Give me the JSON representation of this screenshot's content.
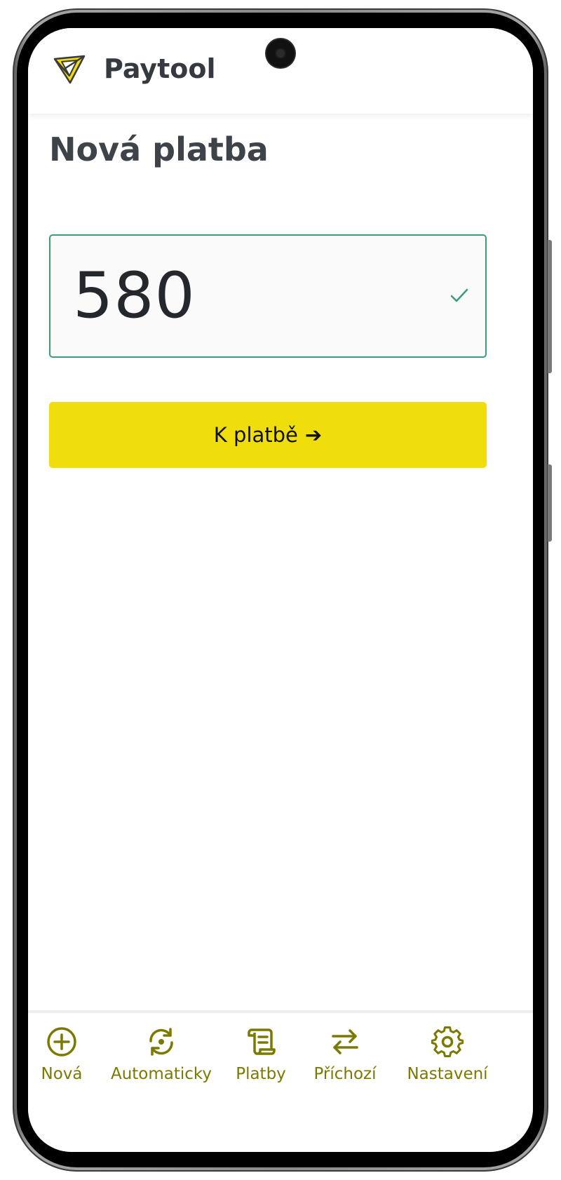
{
  "app": {
    "name": "Paytool",
    "logo_icon": "paytool-logo-icon"
  },
  "page": {
    "title": "Nová platba"
  },
  "amount_field": {
    "value": "580",
    "status_icon": "check-icon"
  },
  "pay_button": {
    "label": "K platbě",
    "arrow": "➔"
  },
  "bottom_nav": {
    "items": [
      {
        "label": "Nová",
        "icon": "plus-circle-icon"
      },
      {
        "label": "Automaticky",
        "icon": "refresh-icon"
      },
      {
        "label": "Platby",
        "icon": "scroll-icon"
      },
      {
        "label": "Příchozí",
        "icon": "swap-arrows-icon"
      },
      {
        "label": "Nastavení",
        "icon": "gear-icon"
      }
    ]
  },
  "colors": {
    "accent_yellow": "#f0de0c",
    "nav_olive": "#7b7a00",
    "valid_green": "#3a9e75",
    "title_gray": "#3e434a"
  }
}
